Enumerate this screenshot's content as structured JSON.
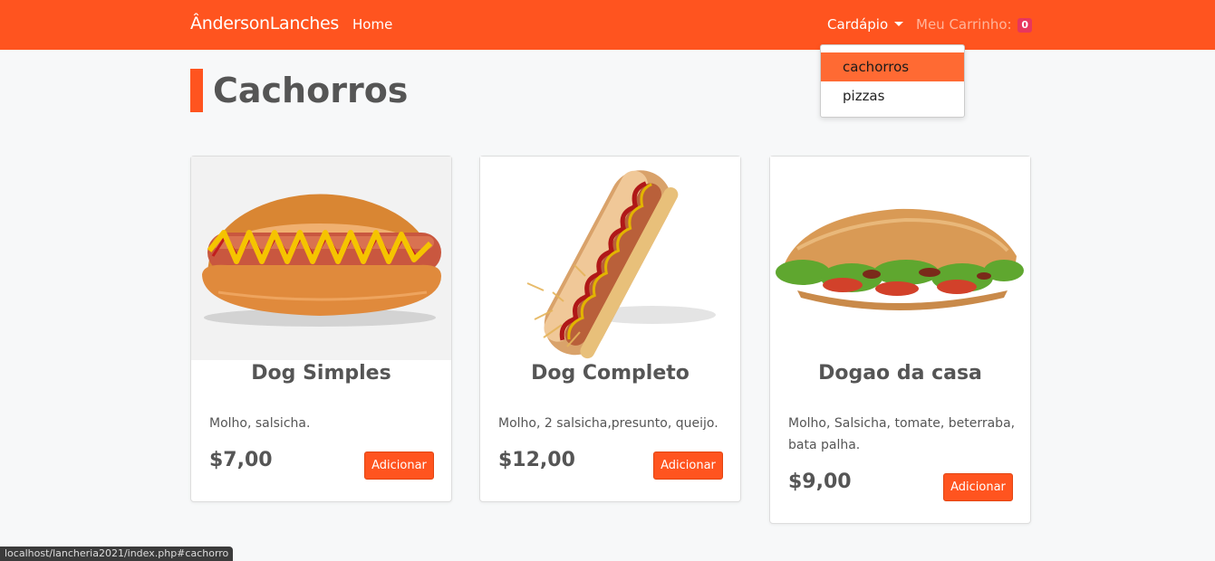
{
  "navbar": {
    "brand": "ÂndersonLanches",
    "home": "Home",
    "menu_label": "Cardápio",
    "cart_label": "Meu Carrinho:",
    "cart_count": "0",
    "dropdown": [
      "cachorros",
      "pizzas"
    ]
  },
  "page": {
    "title": "Cachorros"
  },
  "products": [
    {
      "name": "Dog Simples",
      "description": "Molho, salsicha.",
      "price": "$7,00",
      "button": "Adicionar"
    },
    {
      "name": "Dog Completo",
      "description": "Molho, 2 salsicha,presunto, queijo.",
      "price": "$12,00",
      "button": "Adicionar"
    },
    {
      "name": "Dogao da casa",
      "description": "Molho, Salsicha, tomate, beterraba, bata palha.",
      "price": "$9,00",
      "button": "Adicionar"
    }
  ],
  "status_url": "localhost/lancheria2021/index.php#cachorro",
  "colors": {
    "accent": "#ff541f",
    "badge": "#e8365d"
  }
}
